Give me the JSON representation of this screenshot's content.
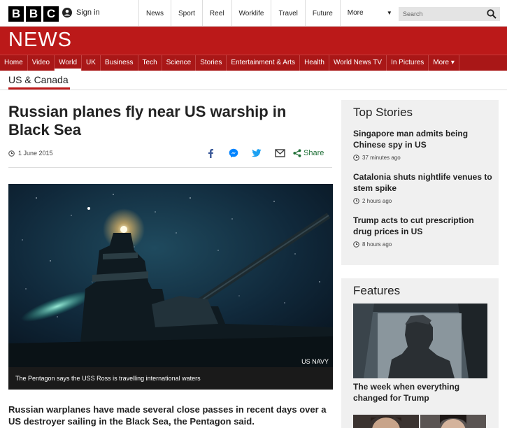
{
  "topbar": {
    "logo_letters": [
      "B",
      "B",
      "C"
    ],
    "signin_label": "Sign in",
    "nav": [
      "News",
      "Sport",
      "Reel",
      "Worklife",
      "Travel",
      "Future"
    ],
    "more_label": "More",
    "search_placeholder": "Search"
  },
  "banner": {
    "title": "NEWS",
    "color": "#bb1919"
  },
  "mainnav": [
    "Home",
    "Video",
    "World",
    "UK",
    "Business",
    "Tech",
    "Science",
    "Stories",
    "Entertainment & Arts",
    "Health",
    "World News TV",
    "In Pictures",
    "More ▾"
  ],
  "mainnav_active": "World",
  "section": {
    "label": "US & Canada"
  },
  "article": {
    "headline": "Russian planes fly near US warship in Black Sea",
    "date": "1 June 2015",
    "share_label": "Share",
    "image_credit": "US NAVY",
    "caption": "The Pentagon says the USS Ross is travelling international waters",
    "lede": "Russian warplanes have made several close passes in recent days over a US destroyer sailing in the Black Sea, the Pentagon said."
  },
  "top_stories": {
    "title": "Top Stories",
    "items": [
      {
        "title": "Singapore man admits being Chinese spy in US",
        "time": "37 minutes ago"
      },
      {
        "title": "Catalonia shuts nightlife venues to stem spike",
        "time": "2 hours ago"
      },
      {
        "title": "Trump acts to cut prescription drug prices in US",
        "time": "8 hours ago"
      }
    ]
  },
  "features": {
    "title": "Features",
    "items": [
      {
        "title": "The week when everything changed for Trump"
      }
    ]
  },
  "icons": [
    "user-icon",
    "search-icon",
    "clock-icon",
    "facebook-icon",
    "messenger-icon",
    "twitter-icon",
    "email-icon",
    "share-icon",
    "chevron-down-icon"
  ]
}
